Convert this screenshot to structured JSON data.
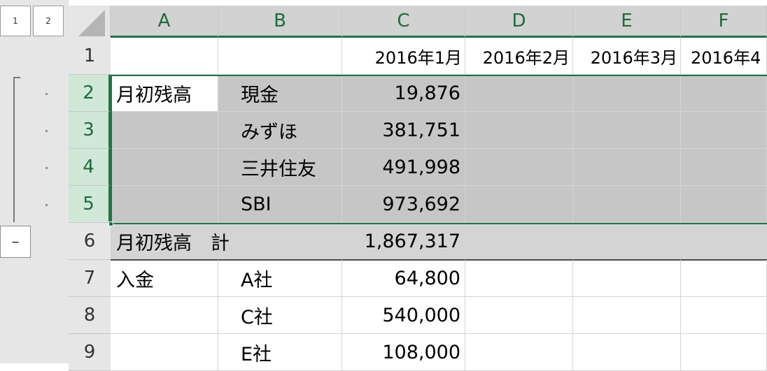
{
  "outline": {
    "level_buttons": [
      "1",
      "2"
    ],
    "collapse_symbol": "–"
  },
  "columns": [
    "A",
    "B",
    "C",
    "D",
    "E",
    "F"
  ],
  "rows": [
    {
      "num": "1",
      "a": "",
      "b": "",
      "c": "2016年1月",
      "d": "2016年2月",
      "e": "2016年3月",
      "f": "2016年4"
    },
    {
      "num": "2",
      "a": "月初残高",
      "b": "現金",
      "c": "19,876"
    },
    {
      "num": "3",
      "a": "",
      "b": "みずほ",
      "c": "381,751"
    },
    {
      "num": "4",
      "a": "",
      "b": "三井住友",
      "c": "491,998"
    },
    {
      "num": "5",
      "a": "",
      "b": "SBI",
      "c": "973,692"
    },
    {
      "num": "6",
      "a": "月初残高　計",
      "b": "",
      "c": "1,867,317"
    },
    {
      "num": "7",
      "a": "入金",
      "b": "A社",
      "c": "64,800"
    },
    {
      "num": "8",
      "a": "",
      "b": "C社",
      "c": "540,000"
    },
    {
      "num": "9",
      "a": "",
      "b": "E社",
      "c": "108,000"
    }
  ],
  "colors": {
    "selection_accent": "#217346",
    "selected_fill": "#c6c6c6",
    "header_bg": "#e6e6e6"
  }
}
